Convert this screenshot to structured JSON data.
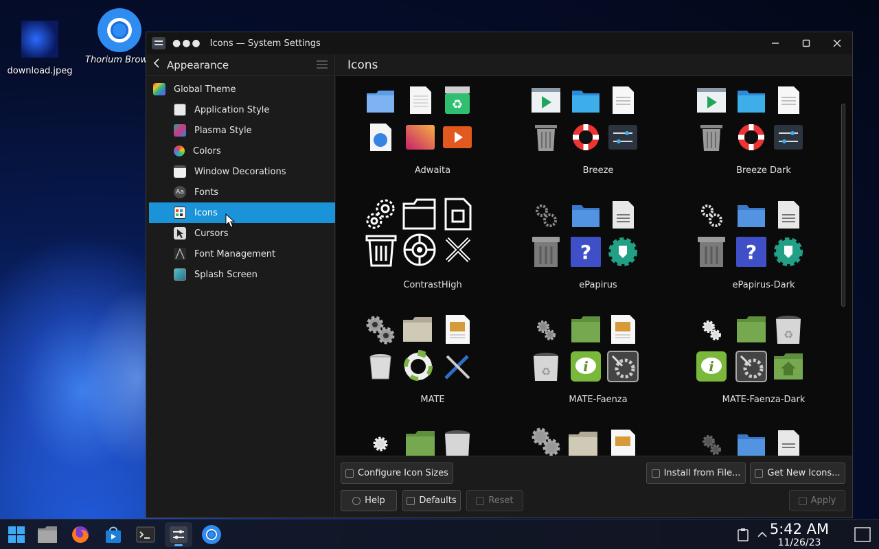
{
  "desktop": {
    "icons": [
      {
        "label": "download.jpeg"
      },
      {
        "label": "Thorium Browser"
      }
    ]
  },
  "window": {
    "title": "Icons — System Settings",
    "menu_dots": "●●●",
    "controls": {
      "minimize": "—",
      "maximize": "☐",
      "close": "✕"
    }
  },
  "sidebar": {
    "back_label": "Appearance",
    "items": [
      {
        "label": "Global Theme",
        "icon": "global-theme-icon"
      },
      {
        "label": "Application Style",
        "icon": "application-style-icon"
      },
      {
        "label": "Plasma Style",
        "icon": "plasma-style-icon"
      },
      {
        "label": "Colors",
        "icon": "colors-icon"
      },
      {
        "label": "Window Decorations",
        "icon": "window-decorations-icon"
      },
      {
        "label": "Fonts",
        "icon": "fonts-icon"
      },
      {
        "label": "Icons",
        "icon": "icons-icon",
        "active": true
      },
      {
        "label": "Cursors",
        "icon": "cursors-icon"
      },
      {
        "label": "Font Management",
        "icon": "font-management-icon"
      },
      {
        "label": "Splash Screen",
        "icon": "splash-screen-icon"
      }
    ],
    "fonts_badge": "Aa"
  },
  "content": {
    "title": "Icons",
    "themes": [
      {
        "label": "Adwaita"
      },
      {
        "label": "Breeze"
      },
      {
        "label": "Breeze Dark"
      },
      {
        "label": "ContrastHigh"
      },
      {
        "label": "ePapirus"
      },
      {
        "label": "ePapirus-Dark"
      },
      {
        "label": "MATE"
      },
      {
        "label": "MATE-Faenza"
      },
      {
        "label": "MATE-Faenza-Dark"
      }
    ],
    "glyph_question": "?",
    "glyph_info": "i"
  },
  "footer": {
    "configure_sizes": "Configure Icon Sizes",
    "install_from_file": "Install from File...",
    "get_new_icons": "Get New Icons...",
    "help": "Help",
    "defaults": "Defaults",
    "reset": "Reset",
    "apply": "Apply"
  },
  "taskbar": {
    "time": "5:42 AM",
    "date": "11/26/23",
    "tray_chevron": "︿"
  },
  "colors": {
    "accent": "#1b93d8",
    "window_bg": "#1b1b1b",
    "content_bg": "#0b0b0b"
  }
}
